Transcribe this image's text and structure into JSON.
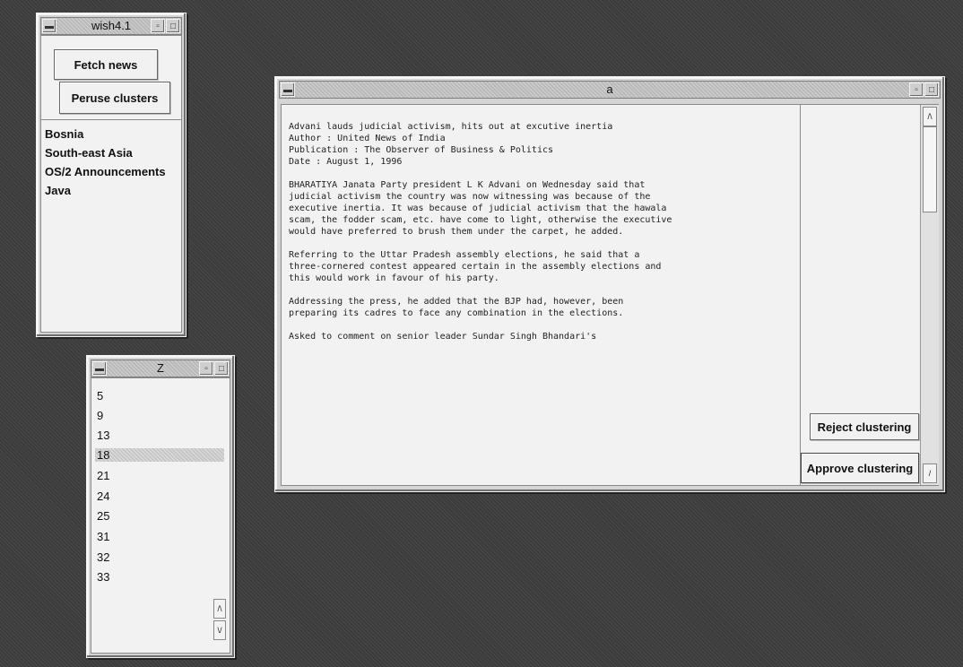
{
  "wish_window": {
    "title": "wish4.1",
    "buttons": {
      "fetch_news": "Fetch news",
      "peruse_clusters": "Peruse clusters"
    },
    "clusters": [
      "Bosnia",
      "South-east Asia",
      "OS/2 Announcements",
      "Java"
    ]
  },
  "z_window": {
    "title": "Z",
    "numbers": [
      "5",
      "9",
      "13",
      "18",
      "21",
      "24",
      "25",
      "31",
      "32",
      "33"
    ],
    "selected": "18"
  },
  "article_window": {
    "title": "a",
    "headline": "Advani lauds judicial activism, hits out at excutive inertia",
    "author_line": "Author : United News of India",
    "publication_line": "Publication : The Observer of Business & Politics",
    "date_line": "Date : August 1, 1996",
    "paragraphs": [
      "BHARATIYA Janata Party president L K Advani on Wednesday said that judicial activism the country was now witnessing was because of the executive inertia. It was because of judicial activism that the hawala scam, the fodder scam, etc. have come to light, otherwise the executive would have preferred to brush them under the carpet, he added.",
      "Referring to the Uttar Pradesh assembly elections, he said that a three-cornered contest appeared certain in the assembly elections and this would work in favour of his party.",
      "Addressing the press, he added that the BJP had, however, been preparing its cadres to face any combination in the elections.",
      "Asked to comment on senior leader Sundar Singh Bhandari's"
    ],
    "buttons": {
      "reject": "Reject clustering",
      "approve": "Approve clustering"
    }
  }
}
